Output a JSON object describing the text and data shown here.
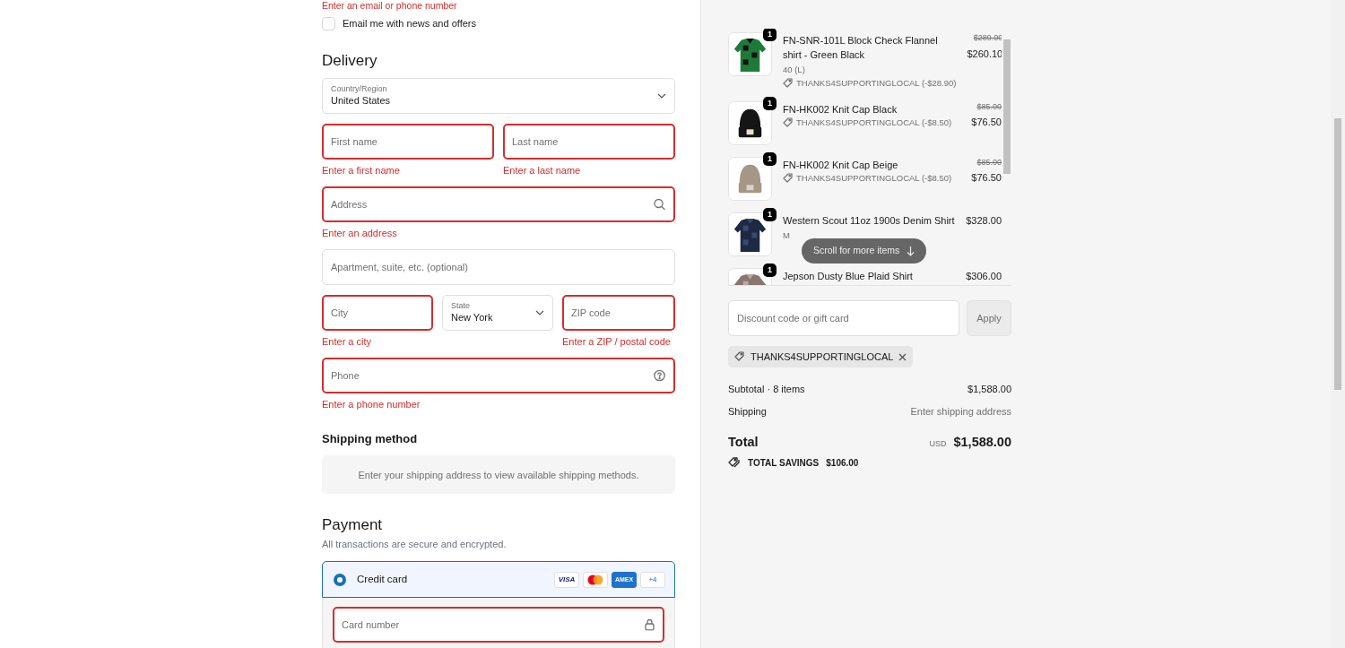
{
  "top_error": "Enter an email or phone number",
  "newsletter": {
    "label": "Email me with news and offers",
    "checked": false
  },
  "delivery": {
    "title": "Delivery",
    "rows": [
      [
        {
          "kind": "select",
          "label": "Country/Region",
          "value": "United States"
        }
      ],
      [
        {
          "kind": "text",
          "placeholder": "First name",
          "invalid": true,
          "error": "Enter a first name"
        },
        {
          "kind": "text",
          "placeholder": "Last name",
          "invalid": true,
          "error": "Enter a last name"
        }
      ],
      [
        {
          "kind": "search",
          "placeholder": "Address",
          "invalid": true,
          "error": "Enter an address"
        }
      ],
      [
        {
          "kind": "text",
          "placeholder": "Apartment, suite, etc. (optional)",
          "invalid": false
        }
      ],
      [
        {
          "kind": "text",
          "placeholder": "City",
          "invalid": true,
          "error": "Enter a city"
        },
        {
          "kind": "select",
          "label": "State",
          "value": "New York"
        },
        {
          "kind": "text",
          "placeholder": "ZIP code",
          "invalid": true,
          "error": "Enter a ZIP / postal code"
        }
      ],
      [
        {
          "kind": "phone",
          "placeholder": "Phone",
          "invalid": true,
          "error": "Enter a phone number"
        }
      ]
    ]
  },
  "shipping_method": {
    "title": "Shipping method",
    "message": "Enter your shipping address to view available shipping methods."
  },
  "payment": {
    "title": "Payment",
    "subtitle": "All transactions are secure and encrypted.",
    "methods": [
      {
        "label": "Credit card",
        "selected": true,
        "brands": [
          {
            "kind": "visa",
            "text": "VISA"
          },
          {
            "kind": "mastercard"
          },
          {
            "kind": "amex",
            "text": "AMEX"
          }
        ],
        "more_brands": "+4"
      }
    ],
    "card_fields": [
      {
        "placeholder": "Card number",
        "invalid": true
      }
    ]
  },
  "cart": {
    "items": [
      {
        "quantity": "1",
        "title": "FN-SNR-101L Block Check Flannel shirt - Green Black",
        "variant": "40 (L)",
        "discount": "THANKS4SUPPORTINGLOCAL (-$28.90)",
        "original_price": "$289.00",
        "price": "$260.10"
      },
      {
        "quantity": "1",
        "title": "FN-HK002 Knit Cap Black",
        "discount": "THANKS4SUPPORTINGLOCAL (-$8.50)",
        "original_price": "$85.00",
        "price": "$76.50"
      },
      {
        "quantity": "1",
        "title": "FN-HK002 Knit Cap Beige",
        "discount": "THANKS4SUPPORTINGLOCAL (-$8.50)",
        "original_price": "$85.00",
        "price": "$76.50"
      },
      {
        "quantity": "1",
        "title": "Western Scout 11oz 1900s Denim Shirt",
        "variant": "M",
        "price": "$328.00"
      },
      {
        "quantity": "1",
        "title": "Jepson Dusty Blue Plaid Shirt",
        "price": "$306.00"
      }
    ],
    "scroll_hint": "Scroll for more items"
  },
  "discount": {
    "placeholder": "Discount code or gift card",
    "button": "Apply"
  },
  "applied_codes": [
    "THANKS4SUPPORTINGLOCAL"
  ],
  "summary": [
    {
      "label": "Subtotal · 8 items",
      "value": "$1,588.00",
      "kind": "amount"
    },
    {
      "label": "Shipping",
      "value": "Enter shipping address",
      "kind": "note"
    }
  ],
  "total": {
    "label": "Total",
    "currency": "USD",
    "amount": "$1,588.00"
  },
  "savings": {
    "label": "TOTAL SAVINGS",
    "amount": "$106.00"
  }
}
